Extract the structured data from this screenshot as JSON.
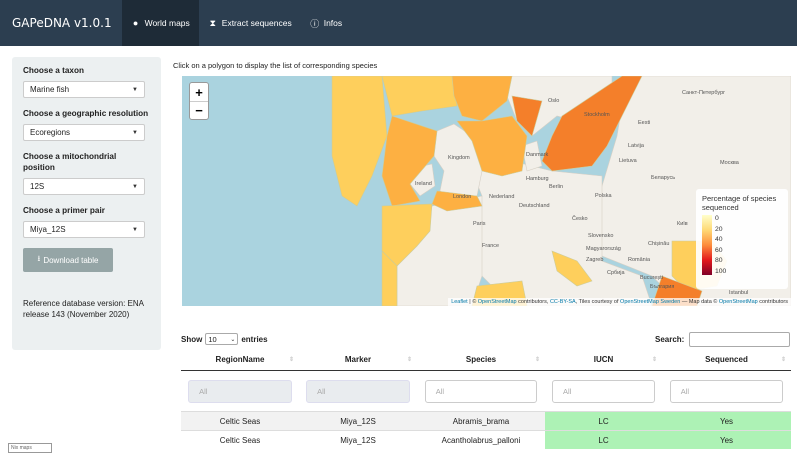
{
  "navbar": {
    "brand": "GAPeDNA v1.0.1",
    "tabs": [
      {
        "label": "World maps",
        "icon": "globe-icon"
      },
      {
        "label": "Extract sequences",
        "icon": "hourglass-icon"
      },
      {
        "label": "Infos",
        "icon": "info-icon"
      }
    ]
  },
  "sidebar": {
    "taxon_label": "Choose a taxon",
    "taxon_value": "Marine fish",
    "resolution_label": "Choose a geographic resolution",
    "resolution_value": "Ecoregions",
    "position_label": "Choose a mitochondrial position",
    "position_value": "12S",
    "primer_label": "Choose a primer pair",
    "primer_value": "Miya_12S",
    "download_label": "Download table",
    "reference_text": "Reference database version: ENA release 143 (November 2020)"
  },
  "hint": "Click on a polygon to display the list of corresponding species",
  "map": {
    "zoom_in": "+",
    "zoom_out": "−",
    "legend_title": "Percentage of species sequenced",
    "legend_ticks": [
      "0",
      "20",
      "40",
      "60",
      "80",
      "100"
    ],
    "cities": [
      "Oslo",
      "Stockholm",
      "Санкт-Петербург",
      "Eesti",
      "Latvija",
      "Lietuva",
      "Москва",
      "Беларусь",
      "Berlin",
      "Polska",
      "Deutschland",
      "London",
      "Nederland",
      "Paris",
      "France",
      "Česko",
      "Slovensko",
      "Magyarország",
      "Chișinău",
      "Zagreb",
      "România",
      "Србија",
      "București",
      "Київ",
      "Ireland",
      "Kingdom",
      "Danmark",
      "Hamburg",
      "България",
      "Istanbul"
    ],
    "attribution": {
      "leaflet": "Leaflet",
      "osm": "OpenStreetMap",
      "contrib": "contributors,",
      "license": "CC-BY-SA",
      "tiles": ", Tiles courtesy of",
      "osm_sweden": "OpenStreetMap Sweden",
      "mapdata": "— Map data ©",
      "osm2": "OpenStreetMap",
      "contrib2": "contributors"
    },
    "colors": {
      "sea": "#aad3df",
      "land": "#f2efe9",
      "light": "#fecf5c",
      "mid": "#fdb042",
      "dark": "#f47f2a"
    }
  },
  "table": {
    "show_label": "Show",
    "show_value": "10",
    "entries_label": "entries",
    "search_label": "Search:",
    "columns": [
      "RegionName",
      "Marker",
      "Species",
      "IUCN",
      "Sequenced"
    ],
    "filter_placeholder": "All",
    "rows": [
      [
        "Celtic Seas",
        "Miya_12S",
        "Abramis_brama",
        "LC",
        "Yes"
      ],
      [
        "Celtic Seas",
        "Miya_12S",
        "Acantholabrus_palloni",
        "LC",
        "Yes"
      ]
    ]
  },
  "corner_label": "Nix maps"
}
